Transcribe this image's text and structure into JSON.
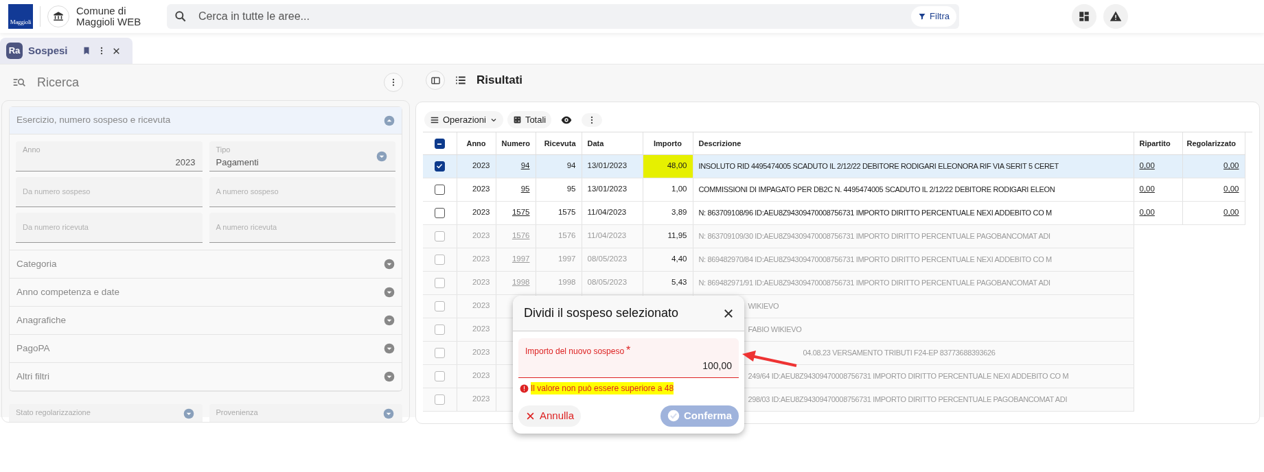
{
  "header": {
    "logo_text": "Maggioli",
    "app_name": "Comune di Maggioli WEB",
    "search_placeholder": "Cerca in tutte le aree...",
    "filter_button": "Filtra"
  },
  "tab": {
    "icon_text": "Ra",
    "label": "Sospesi",
    "selected": true
  },
  "search_panel": {
    "title": "Ricerca",
    "sections": [
      {
        "title": "Esercizio, numero sospeso e ricevuta",
        "expanded": true,
        "fields": [
          {
            "kind": "text",
            "label": "Anno",
            "value": "2023"
          },
          {
            "kind": "select",
            "label": "Tipo",
            "value": "Pagamenti"
          },
          {
            "kind": "text",
            "placeholder": "Da numero sospeso"
          },
          {
            "kind": "text",
            "placeholder": "A numero sospeso"
          },
          {
            "kind": "text",
            "placeholder": "Da numero ricevuta"
          },
          {
            "kind": "text",
            "placeholder": "A numero ricevuta"
          }
        ]
      },
      {
        "title": "Categoria",
        "expanded": false
      },
      {
        "title": "Anno competenza e date",
        "expanded": false
      },
      {
        "title": "Anagrafiche",
        "expanded": false
      },
      {
        "title": "PagoPA",
        "expanded": false
      },
      {
        "title": "Altri filtri",
        "expanded": false
      }
    ],
    "extra_fields": [
      {
        "kind": "select",
        "label": "Stato regolarizzazione"
      },
      {
        "kind": "select",
        "label": "Provenienza"
      }
    ]
  },
  "results": {
    "title": "Risultati",
    "toolbar": {
      "operations": "Operazioni",
      "totals": "Totali"
    },
    "table": {
      "select_all_partial": true,
      "columns": [
        "Anno",
        "Numero",
        "Ricevuta",
        "Data",
        "Importo",
        "Descrizione",
        "Ripartito",
        "Regolarizzato"
      ],
      "rows": [
        {
          "kind": "active",
          "selected": true,
          "highlighted": true,
          "anno": "2023",
          "numero": "94",
          "ricevuta": "94",
          "data": "13/01/2023",
          "importo": "48,00",
          "descrizione": "INSOLUTO RID 4495474005 SCADUTO IL 2/12/22 DEBITORE RODIGARI ELEONORA RIF VIA SERIT 5 CERET",
          "ripartito": "0,00",
          "regolarizzato": "0,00"
        },
        {
          "kind": "active",
          "selected": false,
          "highlighted": false,
          "anno": "2023",
          "numero": "95",
          "ricevuta": "95",
          "data": "13/01/2023",
          "importo": "1,00",
          "descrizione": "COMMISSIONI DI IMPAGATO PER DB2C N. 4495474005 SCADUTO IL 2/12/22 DEBITORE RODIGARI ELEON",
          "ripartito": "0,00",
          "regolarizzato": "0,00"
        },
        {
          "kind": "active",
          "selected": false,
          "highlighted": false,
          "anno": "2023",
          "numero": "1575",
          "ricevuta": "1575",
          "data": "11/04/2023",
          "importo": "3,89",
          "descrizione": "N: 863709108/96 ID:AEU8Z94309470008756731 IMPORTO DIRITTO PERCENTUALE NEXI ADDEBITO CO M",
          "ripartito": "0,00",
          "regolarizzato": "0,00"
        },
        {
          "kind": "dimmed",
          "selected": false,
          "highlighted": false,
          "anno": "2023",
          "numero": "1576",
          "ricevuta": "1576",
          "data": "11/04/2023",
          "importo": "11,95",
          "descrizione": "N: 863709109/30 ID:AEU8Z94309470008756731 IMPORTO DIRITTO PERCENTUALE PAGOBANCOMAT ADI"
        },
        {
          "kind": "dimmed",
          "selected": false,
          "highlighted": false,
          "anno": "2023",
          "numero": "1997",
          "ricevuta": "1997",
          "data": "08/05/2023",
          "importo": "4,40",
          "descrizione": "N: 869482970/84 ID:AEU8Z94309470008756731 IMPORTO DIRITTO PERCENTUALE NEXI ADDEBITO CO M"
        },
        {
          "kind": "dimmed",
          "selected": false,
          "highlighted": false,
          "anno": "2023",
          "numero": "1998",
          "ricevuta": "1998",
          "data": "08/05/2023",
          "importo": "5,43",
          "descrizione": "N: 869482971/91 ID:AEU8Z94309470008756731 IMPORTO DIRITTO PERCENTUALE PAGOBANCOMAT ADI"
        },
        {
          "kind": "behind",
          "selected": false,
          "anno": "2023",
          "descrizione": "WIKIEVO"
        },
        {
          "kind": "behind",
          "selected": false,
          "anno": "2023",
          "descrizione": "FABIO WIKIEVO"
        },
        {
          "kind": "pointed",
          "selected": false,
          "anno": "2023",
          "descrizione": "04.08.23 VERSAMENTO TRIBUTI F24-EP 83773688393626"
        },
        {
          "kind": "behind",
          "selected": false,
          "anno": "2023",
          "descrizione": "249/64 ID:AEU8Z94309470008756731 IMPORTO DIRITTO PERCENTUALE NEXI ADDEBITO CO M"
        },
        {
          "kind": "behind",
          "selected": false,
          "anno": "2023",
          "descrizione": "298/03 ID:AEU8Z94309470008756731 IMPORTO DIRITTO PERCENTUALE PAGOBANCOMAT ADI"
        }
      ]
    }
  },
  "dialog": {
    "title": "Dividi il sospeso selezionato",
    "field": {
      "label": "Importo del nuovo sospeso",
      "required_mark": "*",
      "value": "100,00",
      "invalid": true
    },
    "error": {
      "text": "Il valore non può essere superiore a 48",
      "highlighted": true
    },
    "buttons": [
      {
        "kind": "cancel",
        "label": "Annulla",
        "disabled": false
      },
      {
        "kind": "confirm",
        "label": "Conferma",
        "disabled": true
      }
    ]
  }
}
